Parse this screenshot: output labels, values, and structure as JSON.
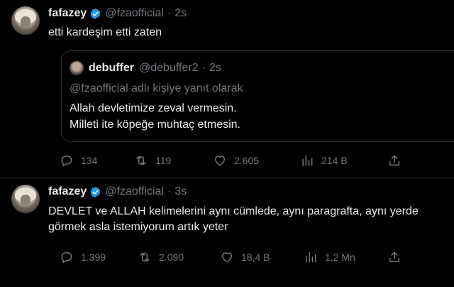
{
  "tweets": [
    {
      "name": "fafazey",
      "handle": "@fzaofficial",
      "dot": "·",
      "time": "2s",
      "text_lines": [
        "etti kardeşim etti zaten"
      ],
      "quote": {
        "name": "debuffer",
        "handle": "@debuffer2",
        "dot": "·",
        "time": "2s",
        "reply_to": "@fzaofficial adlı kişiye yanıt olarak",
        "text_lines": [
          "Allah devletimize zeval vermesin.",
          "Milleti ite köpeğe muhtaç etmesin."
        ]
      },
      "actions": {
        "replies": "134",
        "retweets": "119",
        "likes": "2.605",
        "views": "214 B"
      }
    },
    {
      "name": "fafazey",
      "handle": "@fzaofficial",
      "dot": "·",
      "time": "3s",
      "text_lines": [
        "DEVLET ve ALLAH kelimelerini aynı cümlede, aynı paragrafta, aynı yerde",
        "görmek asla istemiyorum artık yeter"
      ],
      "actions": {
        "replies": "1.399",
        "retweets": "2.090",
        "likes": "18,4 B",
        "views": "1,2 Mn"
      }
    }
  ],
  "colors": {
    "background": "#000000",
    "text": "#e7e9ea",
    "secondary": "#71767b",
    "border": "#2f3336",
    "verified": "#1d9bf0"
  },
  "icons": [
    "reply-icon",
    "retweet-icon",
    "like-icon",
    "views-icon",
    "share-icon",
    "verified-badge-icon"
  ]
}
